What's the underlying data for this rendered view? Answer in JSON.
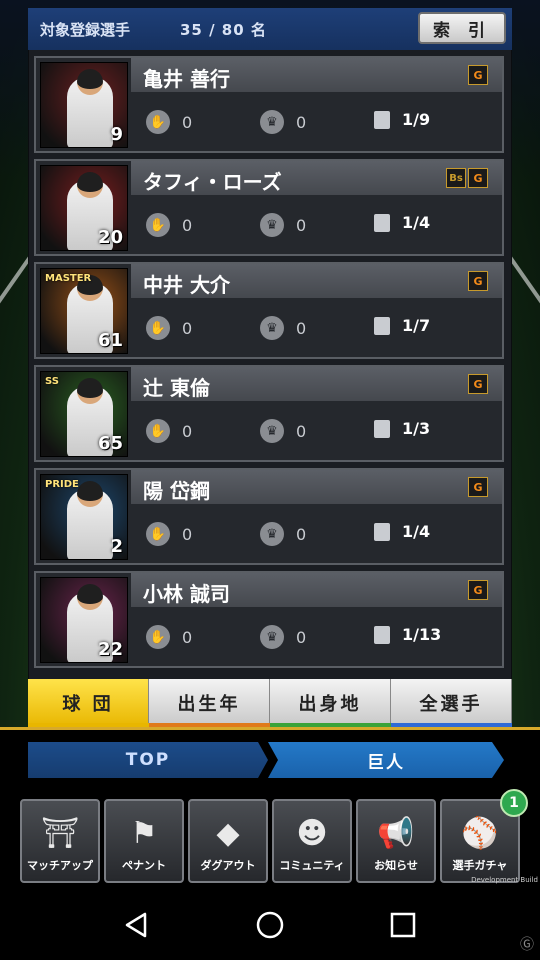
{
  "header": {
    "title": "対象登録選手",
    "count": "35 / 80 名",
    "index_button": "索 引"
  },
  "players": [
    {
      "name": "亀井 善行",
      "number": "9",
      "badge": "",
      "teams": [
        "G"
      ],
      "stat1": "0",
      "stat2": "0",
      "cards": "1/9",
      "frame": "#7a1d1d"
    },
    {
      "name": "タフィ・ローズ",
      "number": "20",
      "badge": "",
      "teams": [
        "Bs",
        "G"
      ],
      "stat1": "0",
      "stat2": "0",
      "cards": "1/4",
      "frame": "#8a1a1a"
    },
    {
      "name": "中井 大介",
      "number": "61",
      "badge": "MASTER",
      "teams": [
        "G"
      ],
      "stat1": "0",
      "stat2": "0",
      "cards": "1/7",
      "frame": "#b35a12"
    },
    {
      "name": "辻 東倫",
      "number": "65",
      "badge": "SS",
      "teams": [
        "G"
      ],
      "stat1": "0",
      "stat2": "0",
      "cards": "1/3",
      "frame": "#2a6a1e"
    },
    {
      "name": "陽 岱鋼",
      "number": "2",
      "badge": "PRIDE",
      "teams": [
        "G"
      ],
      "stat1": "0",
      "stat2": "0",
      "cards": "1/4",
      "frame": "#1b4d7a"
    },
    {
      "name": "小林 誠司",
      "number": "22",
      "badge": "",
      "teams": [
        "G"
      ],
      "stat1": "0",
      "stat2": "0",
      "cards": "1/13",
      "frame": "#7a2353"
    }
  ],
  "tabs": [
    {
      "label": "球 団",
      "active": true,
      "stripe": "#e8b600"
    },
    {
      "label": "出生年",
      "active": false,
      "stripe": "#e07a1a"
    },
    {
      "label": "出身地",
      "active": false,
      "stripe": "#3aa33a"
    },
    {
      "label": "全選手",
      "active": false,
      "stripe": "#2f6ad6"
    }
  ],
  "breadcrumb": {
    "top": "TOP",
    "team": "巨人"
  },
  "menu": [
    {
      "label": "マッチアップ",
      "icon": "japan-map-icon",
      "glyph": "⛩"
    },
    {
      "label": "ペナント",
      "icon": "pennant-icon",
      "glyph": "⚑"
    },
    {
      "label": "ダグアウト",
      "icon": "dugout-icon",
      "glyph": "◆"
    },
    {
      "label": "コミュニティ",
      "icon": "community-icon",
      "glyph": "☻"
    },
    {
      "label": "お知らせ",
      "icon": "megaphone-icon",
      "glyph": "📢"
    },
    {
      "label": "選手ガチャ",
      "icon": "gacha-player-icon",
      "glyph": "⚾",
      "badge": "1"
    }
  ],
  "build_label": "Development Build",
  "colors": {
    "header": "#1e3f78",
    "accent_gold": "#d7a92b",
    "crumb_team": "#2479c8"
  }
}
